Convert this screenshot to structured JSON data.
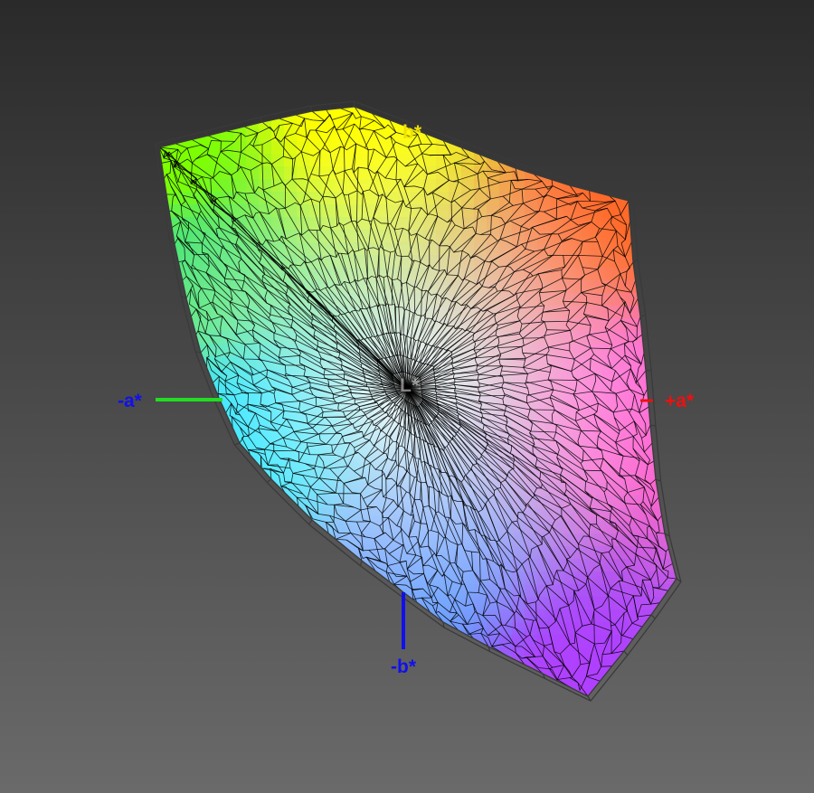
{
  "axes": {
    "neg_a": {
      "label": "-a*",
      "color": "#1010ee",
      "line_color": "#22dd22"
    },
    "pos_a": {
      "label": "+a*",
      "color": "#ee1010",
      "line_color": "#ee1010"
    },
    "pos_b": {
      "label": "b*",
      "color": "#f0e000",
      "line_color": "#f0e000"
    },
    "neg_b": {
      "label": "-b*",
      "color": "#1010ee",
      "line_color": "#1010ee"
    },
    "center_label": {
      "label": "L*",
      "color": "#e8e8e8"
    }
  },
  "colors": {
    "background_top": "#2a2a2a",
    "background_bottom": "#6a6a6a",
    "wireframe": "#000000",
    "corner_top_left": "#7dff00",
    "corner_top": "#ffff00",
    "corner_right": "#ff6a2a",
    "corner_bottom_right": "#b040ff",
    "corner_bottom_left": "#00e0ff",
    "center": "#ffffff"
  }
}
